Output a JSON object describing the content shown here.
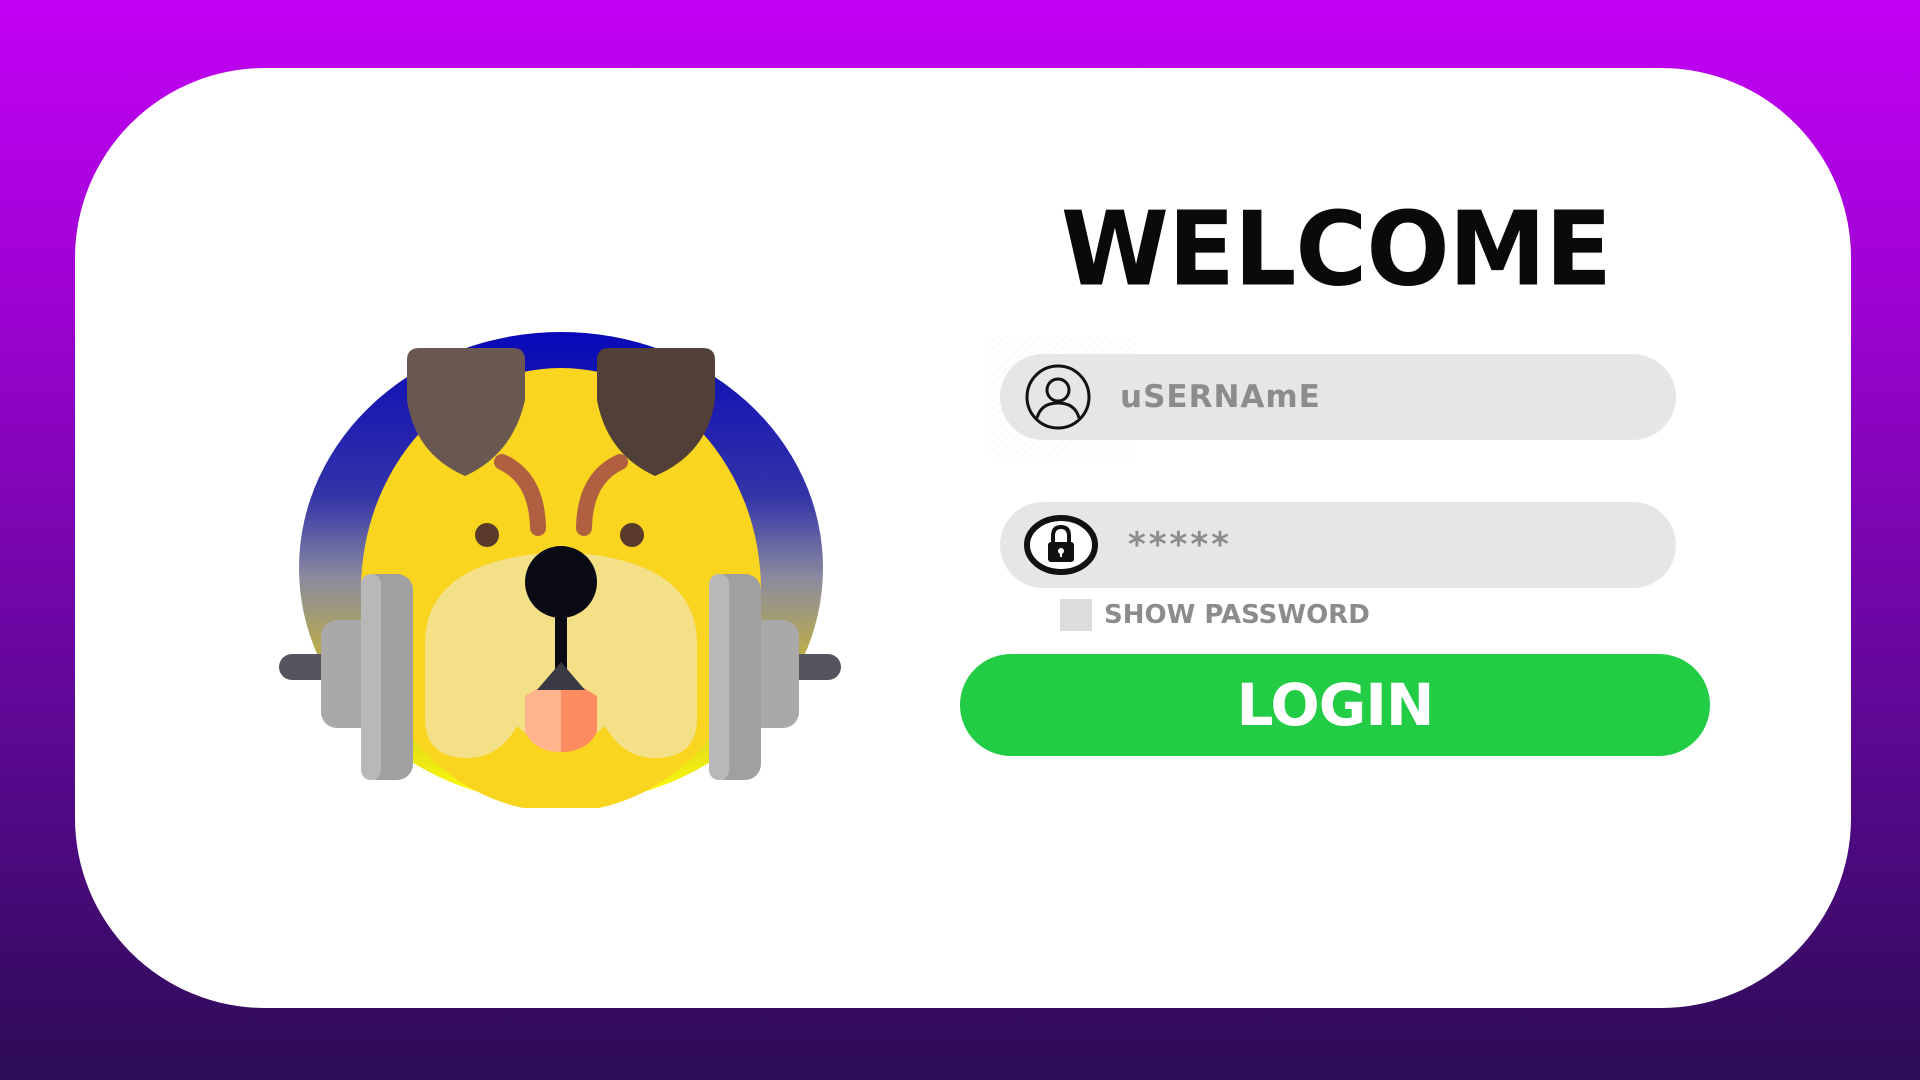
{
  "login": {
    "title": "WELCOME",
    "username_placeholder": "uSERNAmE",
    "password_placeholder": "*****",
    "show_password_label": "SHOW PASSWORD",
    "show_password_checked": false,
    "login_label": "LOGIN"
  },
  "icons": {
    "mascot": "bulldog-with-dumbbell-logo",
    "username": "user-circle-icon",
    "password": "lock-icon"
  },
  "colors": {
    "background_top": "#c400f5",
    "background_bottom": "#2c0c55",
    "card": "#ffffff",
    "field": "#e6e6e6",
    "placeholder_text": "#8c8c8c",
    "login_button": "#22cc44",
    "login_text": "#ffffff",
    "logo_circle_top": "#1010b0",
    "logo_circle_bottom": "#ffff00",
    "dog_face": "#f9d520",
    "dog_ears": "#5a4840",
    "dumbbell": "#a6a6a6"
  }
}
